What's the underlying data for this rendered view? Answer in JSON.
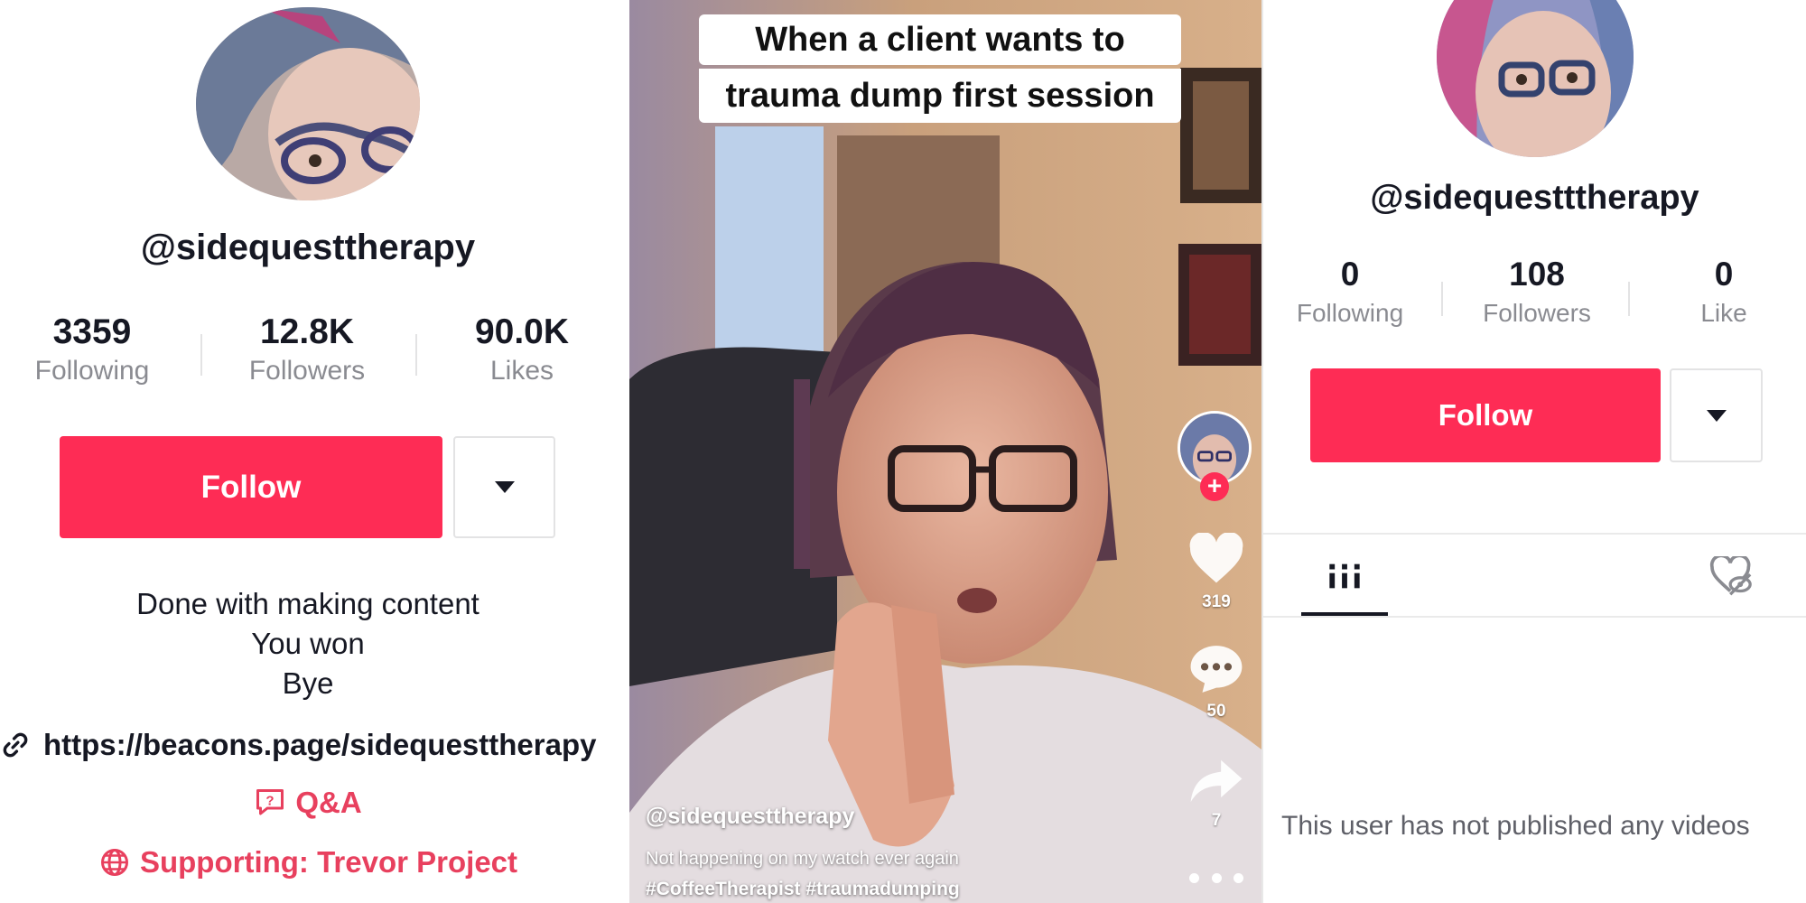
{
  "left_profile": {
    "handle": "@sidequesttherapy",
    "stats": [
      {
        "value": "3359",
        "label": "Following"
      },
      {
        "value": "12.8K",
        "label": "Followers"
      },
      {
        "value": "90.0K",
        "label": "Likes"
      }
    ],
    "follow_label": "Follow",
    "bio": [
      "Done with making content",
      "You won",
      "Bye"
    ],
    "link": "https://beacons.page/sidequesttherapy",
    "qa_label": "Q&A",
    "supporting_label": "Supporting: Trevor Project",
    "accent_color": "#fe2c55",
    "link_accent_color": "#e8405e"
  },
  "video": {
    "caption_line1": "When a client wants to",
    "caption_line2": "trauma dump first session",
    "author": "@sidequesttherapy",
    "description": "Not happening on my watch ever again",
    "hashtags": "#CoffeeTherapist #traumadumping",
    "like_count": "319",
    "comment_count": "50",
    "share_count": "7"
  },
  "right_profile": {
    "handle": "@sidequestttherapy",
    "stats": [
      {
        "value": "0",
        "label": "Following"
      },
      {
        "value": "108",
        "label": "Followers"
      },
      {
        "value": "0",
        "label": "Like"
      }
    ],
    "follow_label": "Follow",
    "empty_message": "This user has not published any videos"
  }
}
